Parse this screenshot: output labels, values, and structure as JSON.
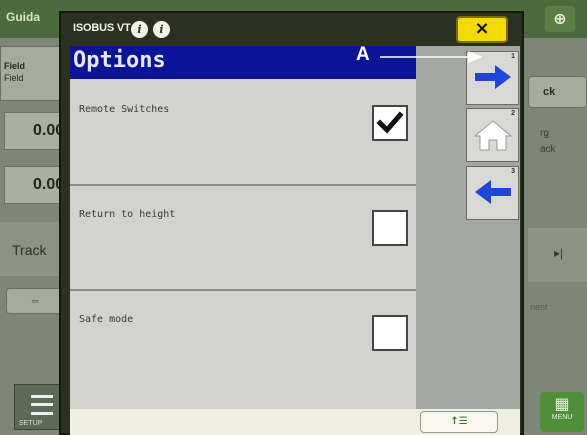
{
  "background": {
    "title": "Guida",
    "field_label": "Field",
    "field_value": "Field",
    "value_1": "0.00",
    "value_2": "0.00",
    "track_label": "Track",
    "small_button_label": "⇦",
    "setup_label": "SETUP",
    "right_button_1": "ck",
    "right_text_1": "rg",
    "right_text_2": "ack",
    "right_button_2": "▸|",
    "right_text_3": "nent",
    "menu_label": "MENU",
    "top_right_icon": "⊕"
  },
  "vt_window": {
    "title": "ISOBUS VT",
    "info_icon_1": "i",
    "info_icon_2": "i",
    "close_label": "×",
    "header": "Options",
    "options": [
      {
        "label": "Remote Switches",
        "checked": true
      },
      {
        "label": "Return to height",
        "checked": false
      },
      {
        "label": "Safe mode",
        "checked": false
      }
    ],
    "soft_keys": [
      {
        "name": "next-page-arrow-icon",
        "superscript": "1"
      },
      {
        "name": "home-icon",
        "superscript": "2"
      },
      {
        "name": "previous-page-arrow-icon",
        "superscript": "3"
      }
    ],
    "bottom_button_label": "↑☰"
  },
  "callout": {
    "letter": "A"
  },
  "colors": {
    "header_bg": "#0a1494",
    "close_button": "#f2d900",
    "arrow_blue": "#1f46d8",
    "window_frame": "#2b3020"
  }
}
